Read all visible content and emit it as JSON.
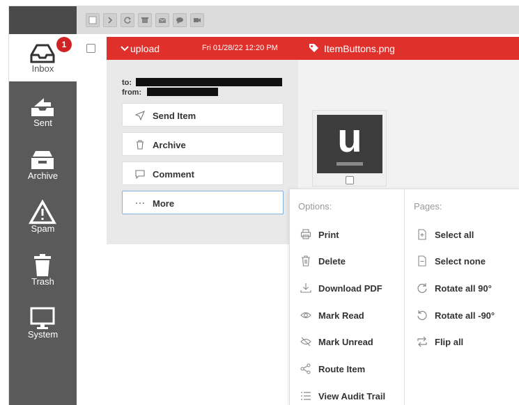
{
  "sidebar": {
    "badge_count": "1",
    "items": [
      {
        "label": "Inbox",
        "icon": "inbox-icon"
      },
      {
        "label": "Sent",
        "icon": "sent-icon"
      },
      {
        "label": "Archive",
        "icon": "archive-icon"
      },
      {
        "label": "Spam",
        "icon": "spam-warning-icon"
      },
      {
        "label": "Trash",
        "icon": "trash-icon"
      },
      {
        "label": "System",
        "icon": "monitor-icon"
      }
    ]
  },
  "toolbar": {
    "icons": [
      "select-checkbox",
      "chevron-right-icon",
      "refresh-icon",
      "archive-icon",
      "mail-icon",
      "comment-icon",
      "video-icon"
    ]
  },
  "message": {
    "folder": "upload",
    "date": "Fri 01/28/22 12:20 PM",
    "attachment": "ItemButtons.png",
    "to_label": "to:",
    "from_label": "from:"
  },
  "actions": [
    {
      "label": "Send Item",
      "icon": "send-icon"
    },
    {
      "label": "Archive",
      "icon": "archive-box-icon"
    },
    {
      "label": "Comment",
      "icon": "comment-icon"
    },
    {
      "label": "More",
      "icon": "ellipsis-icon"
    }
  ],
  "thumbnail": {
    "letter": "u"
  },
  "menu": {
    "options_header": "Options:",
    "pages_header": "Pages:",
    "options": [
      {
        "label": "Print",
        "icon": "print-icon"
      },
      {
        "label": "Delete",
        "icon": "delete-icon"
      },
      {
        "label": "Download PDF",
        "icon": "download-icon"
      },
      {
        "label": "Mark Read",
        "icon": "eye-icon"
      },
      {
        "label": "Mark Unread",
        "icon": "eye-off-icon"
      },
      {
        "label": "Route Item",
        "icon": "share-icon"
      },
      {
        "label": "View Audit Trail",
        "icon": "list-icon"
      }
    ],
    "pages": [
      {
        "label": "Select all",
        "icon": "page-plus-icon"
      },
      {
        "label": "Select none",
        "icon": "page-minus-icon"
      },
      {
        "label": "Rotate all 90°",
        "icon": "rotate-cw-icon"
      },
      {
        "label": "Rotate all -90°",
        "icon": "rotate-ccw-icon"
      },
      {
        "label": "Flip all",
        "icon": "flip-icon"
      }
    ]
  },
  "colors": {
    "accent": "#e0302b",
    "sidebar": "#5a5a5a",
    "badge": "#d02424"
  }
}
